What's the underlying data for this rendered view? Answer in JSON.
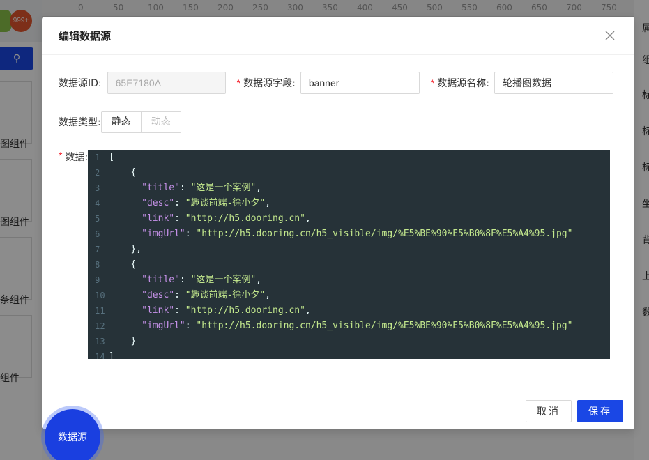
{
  "background": {
    "badge_count": "999+",
    "ruler_ticks": [
      "0",
      "50",
      "100",
      "150",
      "200",
      "250",
      "300",
      "350",
      "400",
      "450",
      "500",
      "550",
      "600",
      "650",
      "700",
      "750"
    ],
    "left_cards": [
      "图组件",
      "图组件",
      "条组件",
      "组件"
    ],
    "right_labels": [
      "属",
      "组",
      "标",
      "标",
      "标",
      "坐",
      "背",
      "上",
      "数"
    ]
  },
  "modal": {
    "title": "编辑数据源",
    "close_icon": "close-icon",
    "fields": {
      "id_label": "数据源ID:",
      "id_value": "65E7180A",
      "field_label": "数据源字段:",
      "field_value": "banner",
      "name_label": "数据源名称:",
      "name_value": "轮播图数据"
    },
    "type": {
      "label": "数据类型:",
      "options": [
        "静态",
        "动态"
      ],
      "selected": "静态"
    },
    "data_label": "数据:",
    "required_mark": "*",
    "code_lines": [
      {
        "n": "1",
        "text": "["
      },
      {
        "n": "2",
        "text": "    {"
      },
      {
        "n": "3",
        "text": "      \"title\": \"这是一个案例\","
      },
      {
        "n": "4",
        "text": "      \"desc\": \"趣谈前端-徐小夕\","
      },
      {
        "n": "5",
        "text": "      \"link\": \"http://h5.dooring.cn\","
      },
      {
        "n": "6",
        "text": "      \"imgUrl\": \"http://h5.dooring.cn/h5_visible/img/%E5%BE%90%E5%B0%8F%E5%A4%95.jpg\""
      },
      {
        "n": "7",
        "text": "    },"
      },
      {
        "n": "8",
        "text": "    {"
      },
      {
        "n": "9",
        "text": "      \"title\": \"这是一个案例\","
      },
      {
        "n": "10",
        "text": "      \"desc\": \"趣谈前端-徐小夕\","
      },
      {
        "n": "11",
        "text": "      \"link\": \"http://h5.dooring.cn\","
      },
      {
        "n": "12",
        "text": "      \"imgUrl\": \"http://h5.dooring.cn/h5_visible/img/%E5%BE%90%E5%B0%8F%E5%A4%95.jpg\""
      },
      {
        "n": "13",
        "text": "    }"
      },
      {
        "n": "14",
        "text": "]"
      }
    ],
    "footer": {
      "cancel_label": "取消",
      "save_label": "保存"
    }
  },
  "floating_button_label": "数据源",
  "colors": {
    "primary": "#1a47e5",
    "editor_bg": "#263238",
    "required": "#f5222d"
  }
}
